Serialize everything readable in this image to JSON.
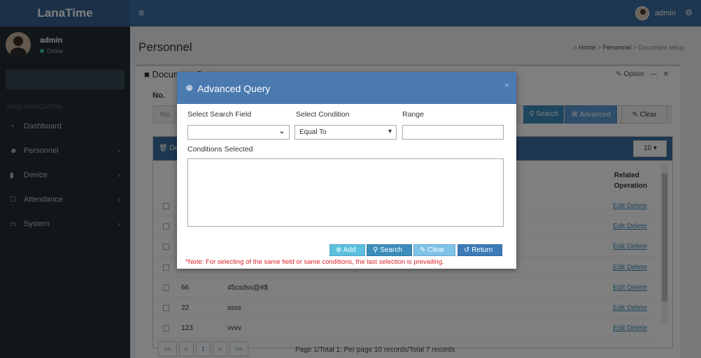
{
  "app": {
    "title": "LanaTime"
  },
  "topbar": {
    "menu_icon": "hamburger-icon",
    "user_name": "admin",
    "settings_icon": "cogs-icon"
  },
  "sidebar": {
    "user": {
      "name": "admin",
      "status": "Online"
    },
    "header": "MAIN NAVIGATION",
    "items": [
      {
        "label": "Dashboard",
        "icon": "dashboard-icon"
      },
      {
        "label": "Personnel",
        "icon": "users-icon"
      },
      {
        "label": "Device",
        "icon": "device-icon"
      },
      {
        "label": "Attendance",
        "icon": "calendar-icon"
      },
      {
        "label": "System",
        "icon": "monitor-icon"
      }
    ]
  },
  "page": {
    "title": "Personnel",
    "breadcrumb": {
      "home": "Home",
      "section": "Personnel",
      "current": "Document setup"
    }
  },
  "box": {
    "title": "Document Setup",
    "option_label": "Option",
    "no_label": "No.",
    "no_placeholder": "No.",
    "search_label": "Search",
    "advanced_label": "Advanced",
    "clear_label": "Clear"
  },
  "table": {
    "delete_label": "Del",
    "page_size": "10",
    "related_operation": "Related Operation",
    "rows": [
      {
        "c1": "",
        "c2": "",
        "edit": "Edit",
        "delete": "Delete"
      },
      {
        "c1": "",
        "c2": "",
        "edit": "Edit",
        "delete": "Delete"
      },
      {
        "c1": "",
        "c2": "",
        "edit": "Edit",
        "delete": "Delete"
      },
      {
        "c1": "",
        "c2": "",
        "edit": "Edit",
        "delete": "Delete"
      },
      {
        "c1": "66",
        "c2": "45csdss@#$",
        "edit": "Edit",
        "delete": "Delete"
      },
      {
        "c1": "22",
        "c2": "ssss",
        "edit": "Edit",
        "delete": "Delete"
      },
      {
        "c1": "123",
        "c2": "vvvv",
        "edit": "Edit",
        "delete": "Delete"
      }
    ],
    "pager": [
      "<<",
      "<",
      "1",
      ">",
      ">>"
    ],
    "page_info": "Page 1/Total 1; Per page 10 records/Total 7 records"
  },
  "modal": {
    "title": "Advanced Query",
    "close": "×",
    "search_field_label": "Select Search Field",
    "search_field_value": "",
    "condition_label": "Select Condition",
    "condition_value": "Equal To",
    "range_label": "Range",
    "range_value": "",
    "conditions_selected_label": "Conditions Selected",
    "buttons": {
      "add": "Add",
      "search": "Search",
      "clear": "Clear",
      "return": "Return"
    },
    "note": "*Note: For selecting of the same field or same conditions, the last selection is prevailing."
  }
}
